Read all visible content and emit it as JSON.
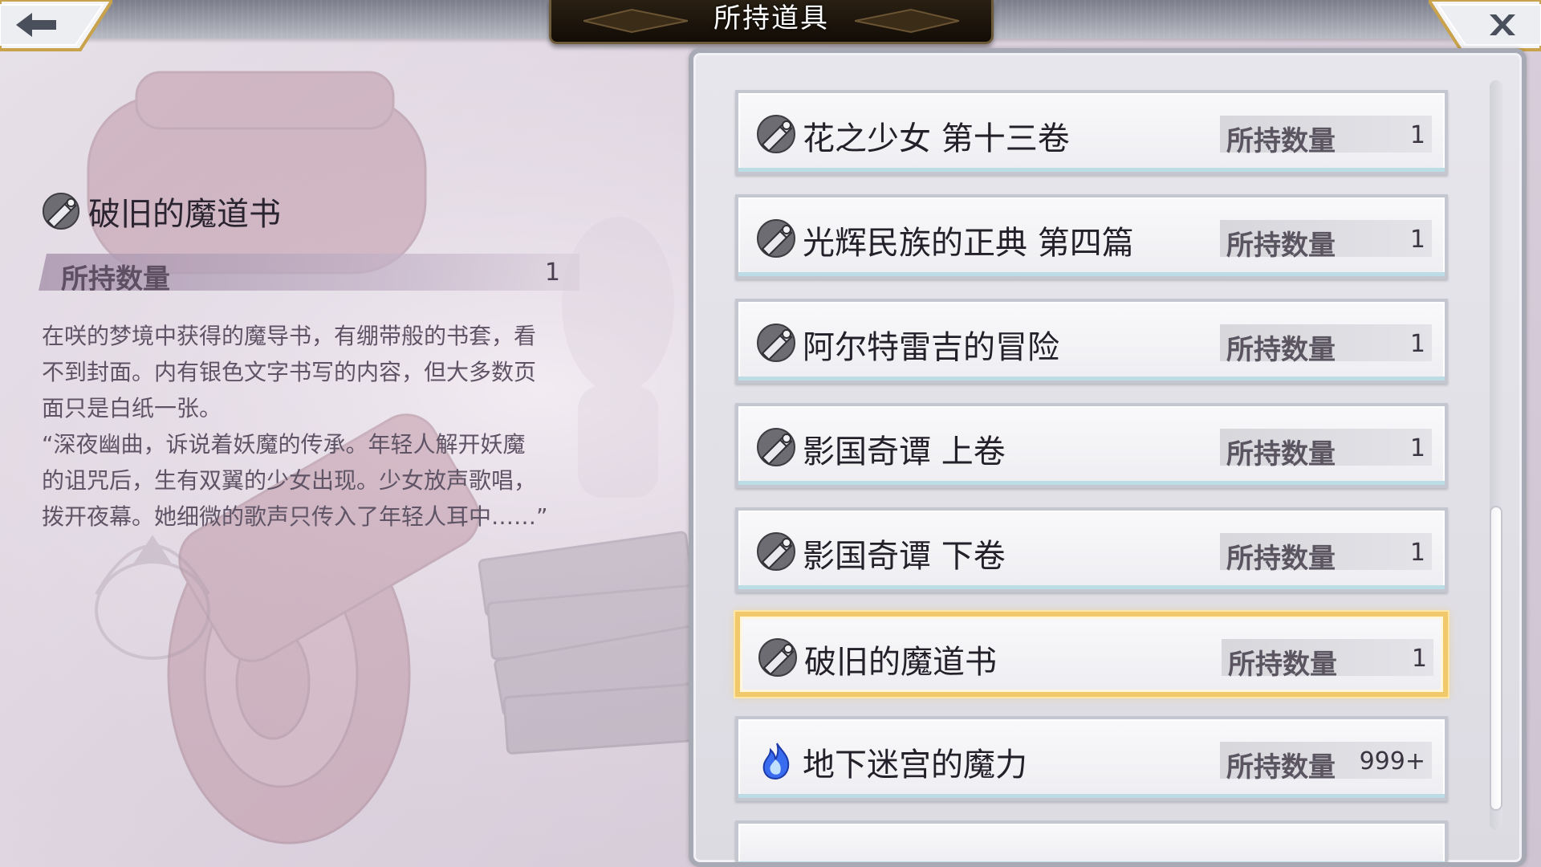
{
  "header": {
    "title": "所持道具",
    "back_icon": "arrow-left-icon",
    "close_icon": "close-x-icon"
  },
  "detail": {
    "icon": "grimoire-icon",
    "name": "破旧的魔道书",
    "quantity_label": "所持数量",
    "quantity_value": "1",
    "description": [
      "在咲的梦境中获得的魔导书，有绷带般的书套，看",
      "不到封面。内有银色文字书写的内容，但大多数页",
      "面只是白纸一张。",
      "“深夜幽曲，诉说着妖魔的传承。年轻人解开妖魔",
      "的诅咒后，生有双翼的少女出现。少女放声歌唱，",
      "拨开夜幕。她细微的歌声只传入了年轻人耳中……”"
    ]
  },
  "items": [
    {
      "name": "花之少女 第十三卷",
      "icon": "grimoire-icon",
      "quantity_label": "所持数量",
      "quantity": "1",
      "selected": false
    },
    {
      "name": "光辉民族的正典 第四篇",
      "icon": "grimoire-icon",
      "quantity_label": "所持数量",
      "quantity": "1",
      "selected": false
    },
    {
      "name": "阿尔特雷吉的冒险",
      "icon": "grimoire-icon",
      "quantity_label": "所持数量",
      "quantity": "1",
      "selected": false
    },
    {
      "name": "影国奇谭 上卷",
      "icon": "grimoire-icon",
      "quantity_label": "所持数量",
      "quantity": "1",
      "selected": false
    },
    {
      "name": "影国奇谭 下卷",
      "icon": "grimoire-icon",
      "quantity_label": "所持数量",
      "quantity": "1",
      "selected": false
    },
    {
      "name": "破旧的魔道书",
      "icon": "grimoire-icon",
      "quantity_label": "所持数量",
      "quantity": "1",
      "selected": true
    },
    {
      "name": "地下迷宫的魔力",
      "icon": "blue-flame-icon",
      "quantity_label": "所持数量",
      "quantity": "999+",
      "selected": false
    }
  ],
  "colors": {
    "selected_border": "#f1c86a",
    "title_plate": "#1a130a",
    "flame": "#3a6cf0"
  }
}
